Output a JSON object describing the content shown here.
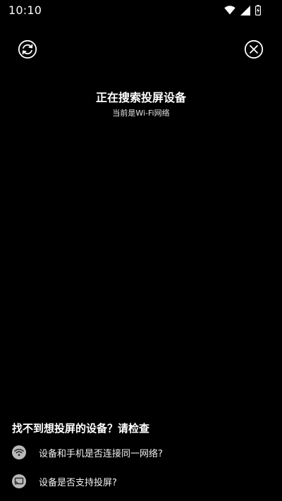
{
  "status_bar": {
    "time": "10:10",
    "icons": [
      "wifi-icon",
      "signal-icon",
      "battery-icon"
    ]
  },
  "actions": {
    "refresh_icon": "refresh-icon",
    "close_icon": "close-circle-icon"
  },
  "main": {
    "title": "正在搜索投屏设备",
    "subtitle": "当前是Wi-Fi网络"
  },
  "help": {
    "heading": "找不到想投屏的设备？请检查",
    "items": [
      {
        "icon": "wifi-icon",
        "text": "设备和手机是否连接同一网络?"
      },
      {
        "icon": "cast-icon",
        "text": "设备是否支持投屏?"
      }
    ]
  },
  "colors": {
    "background": "#000000",
    "text": "#ffffff",
    "icon_badge": "#b9b9b9"
  }
}
